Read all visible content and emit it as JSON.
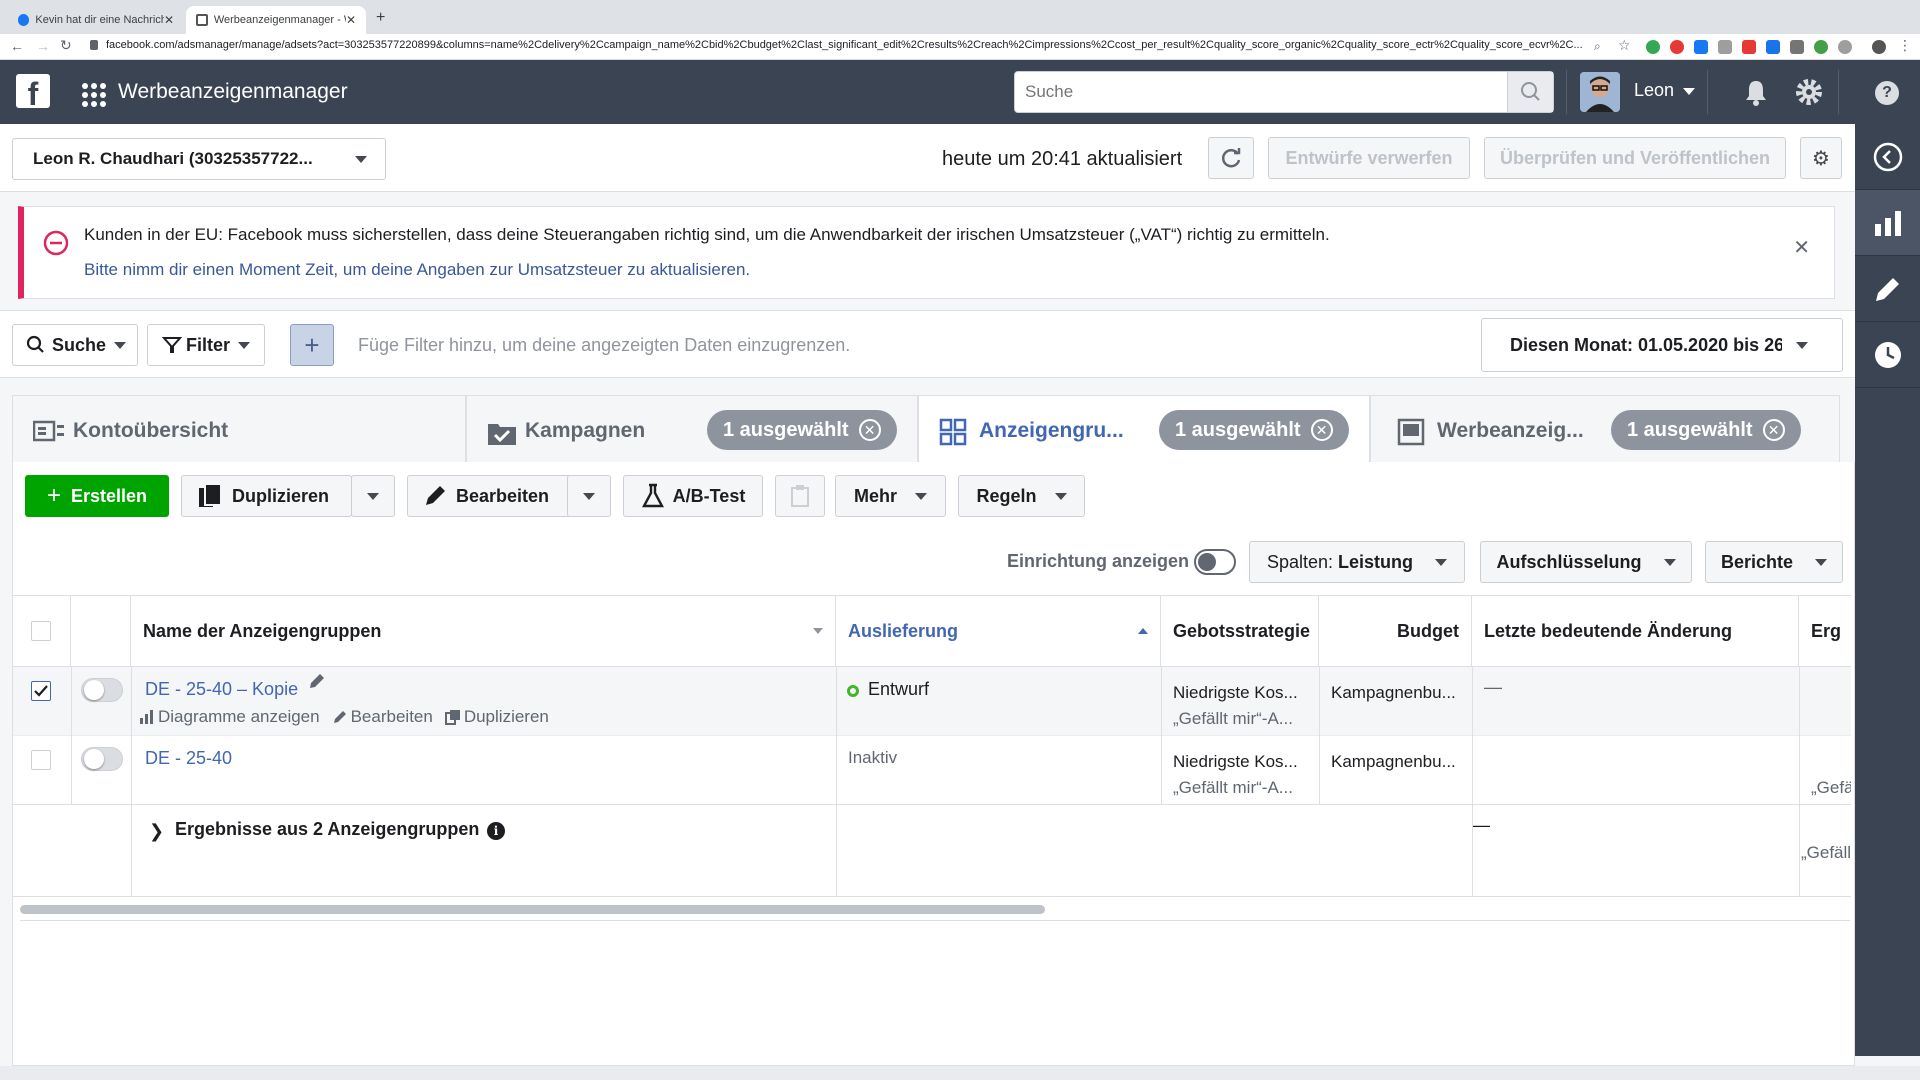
{
  "browser": {
    "tabs": [
      {
        "title": "Kevin hat dir eine Nachricht ge",
        "active": false
      },
      {
        "title": "Werbeanzeigenmanager - Wer",
        "active": true
      }
    ],
    "url": "facebook.com/adsmanager/manage/adsets?act=303253577220899&columns=name%2Cdelivery%2Ccampaign_name%2Cbid%2Cbudget%2Clast_significant_edit%2Cresults%2Creach%2Cimpressions%2Ccost_per_result%2Cquality_score_organic%2Cquality_score_ectr%2Cquality_score_ecvr%2C..."
  },
  "header": {
    "logo": "f",
    "app_title": "Werbeanzeigenmanager",
    "search_placeholder": "Suche",
    "user_name": "Leon"
  },
  "account_bar": {
    "account": "Leon R. Chaudhari (30325357722...",
    "updated": "heute um 20:41 aktualisiert",
    "discard": "Entwürfe verwerfen",
    "publish": "Überprüfen und Veröffentlichen"
  },
  "banner": {
    "text": "Kunden in der EU: Facebook muss sicherstellen, dass deine Steuerangaben richtig sind, um die Anwendbarkeit der irischen Umsatzsteuer („VAT“) richtig zu ermitteln.",
    "link": "Bitte nimm dir einen Moment Zeit, um deine Angaben zur Umsatzsteuer zu aktualisieren."
  },
  "filterbar": {
    "search": "Suche",
    "filter": "Filter",
    "placeholder": "Füge Filter hinzu, um deine angezeigten Daten einzugrenzen.",
    "date": "Diesen Monat: 01.05.2020 bis 26"
  },
  "nav_tabs": {
    "overview": "Kontoübersicht",
    "campaigns": "Kampagnen",
    "adsets": "Anzeigengru...",
    "ads": "Werbeanzeig...",
    "selected": "1 ausgewählt"
  },
  "actions": {
    "create": "Erstellen",
    "duplicate": "Duplizieren",
    "edit": "Bearbeiten",
    "abtest": "A/B-Test",
    "more": "Mehr",
    "rules": "Regeln",
    "setup_label": "Einrichtung anzeigen",
    "columns_prefix": "Spalten:",
    "columns_value": "Leistung",
    "breakdown": "Aufschlüsselung",
    "reports": "Berichte"
  },
  "table": {
    "headers": {
      "name": "Name der Anzeigengruppen",
      "delivery": "Auslieferung",
      "bid": "Gebotsstrategie",
      "budget": "Budget",
      "last_edit": "Letzte bedeutende Änderung",
      "results": "Erg"
    },
    "rows": [
      {
        "name": "DE - 25-40 – Kopie",
        "delivery": "Entwurf",
        "bid1": "Niedrigste Kos...",
        "bid2": "„Gefällt mir“-A...",
        "budget": "Kampagnenbu...",
        "last_edit": "—",
        "links": [
          "Diagramme anzeigen",
          "Bearbeiten",
          "Duplizieren"
        ]
      },
      {
        "name": "DE - 25-40",
        "delivery": "Inaktiv",
        "bid1": "Niedrigste Kos...",
        "bid2": "„Gefällt mir“-A...",
        "budget": "Kampagnenbu...",
        "results": "„Gefällt"
      }
    ],
    "summary": {
      "label": "Ergebnisse aus 2 Anzeigengruppen",
      "last_edit": "—",
      "results": "„Gefällt r"
    }
  },
  "colors": {
    "header": "#3b4452",
    "accent": "#4267b2",
    "create": "#00a400",
    "alert": "#e0245e"
  }
}
